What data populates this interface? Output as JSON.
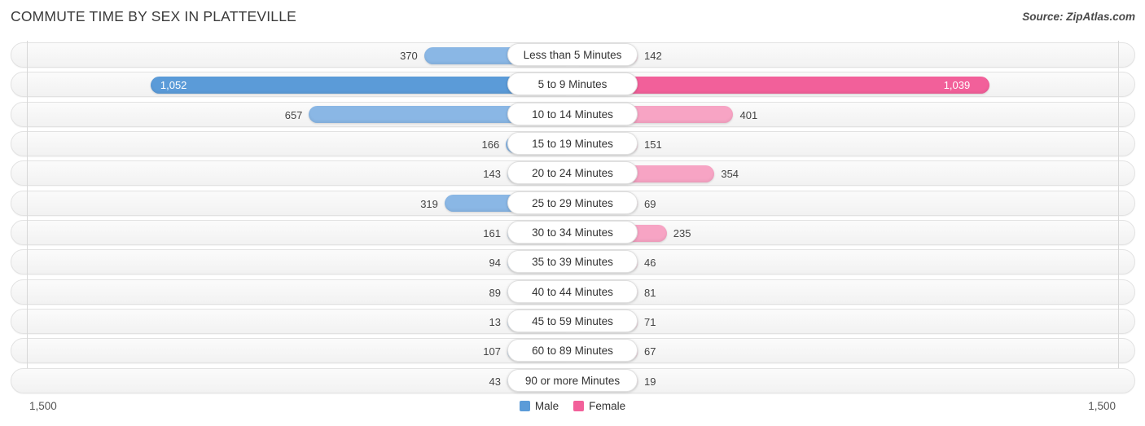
{
  "header": {
    "title": "COMMUTE TIME BY SEX IN PLATTEVILLE",
    "source": "Source: ZipAtlas.com"
  },
  "axis": {
    "left_label": "1,500",
    "right_label": "1,500",
    "max": 1500
  },
  "legend": {
    "items": [
      {
        "label": "Male",
        "color": "#5b9bd8"
      },
      {
        "label": "Female",
        "color": "#f2609a"
      }
    ]
  },
  "colors": {
    "male": "#8ab7e5",
    "male_peak": "#5b9bd8",
    "female": "#f7a4c4",
    "female_peak": "#f2609a"
  },
  "chart_data": {
    "type": "bar",
    "subtype": "diverging-bidirectional-bar",
    "title": "COMMUTE TIME BY SEX IN PLATTEVILLE",
    "xlabel": "",
    "ylabel": "",
    "xlim": [
      -1500,
      1500
    ],
    "grid": false,
    "legend_position": "bottom-center",
    "categories": [
      "Less than 5 Minutes",
      "5 to 9 Minutes",
      "10 to 14 Minutes",
      "15 to 19 Minutes",
      "20 to 24 Minutes",
      "25 to 29 Minutes",
      "30 to 34 Minutes",
      "35 to 39 Minutes",
      "40 to 44 Minutes",
      "45 to 59 Minutes",
      "60 to 89 Minutes",
      "90 or more Minutes"
    ],
    "series": [
      {
        "name": "Male",
        "direction": "left",
        "values": [
          370,
          1052,
          657,
          166,
          143,
          319,
          161,
          94,
          89,
          13,
          107,
          43
        ],
        "labels": [
          "370",
          "1,052",
          "657",
          "166",
          "143",
          "319",
          "161",
          "94",
          "89",
          "13",
          "107",
          "43"
        ]
      },
      {
        "name": "Female",
        "direction": "right",
        "values": [
          142,
          1039,
          401,
          151,
          354,
          69,
          235,
          46,
          81,
          71,
          67,
          19
        ],
        "labels": [
          "142",
          "1,039",
          "401",
          "151",
          "354",
          "69",
          "235",
          "46",
          "81",
          "71",
          "67",
          "19"
        ]
      }
    ]
  }
}
